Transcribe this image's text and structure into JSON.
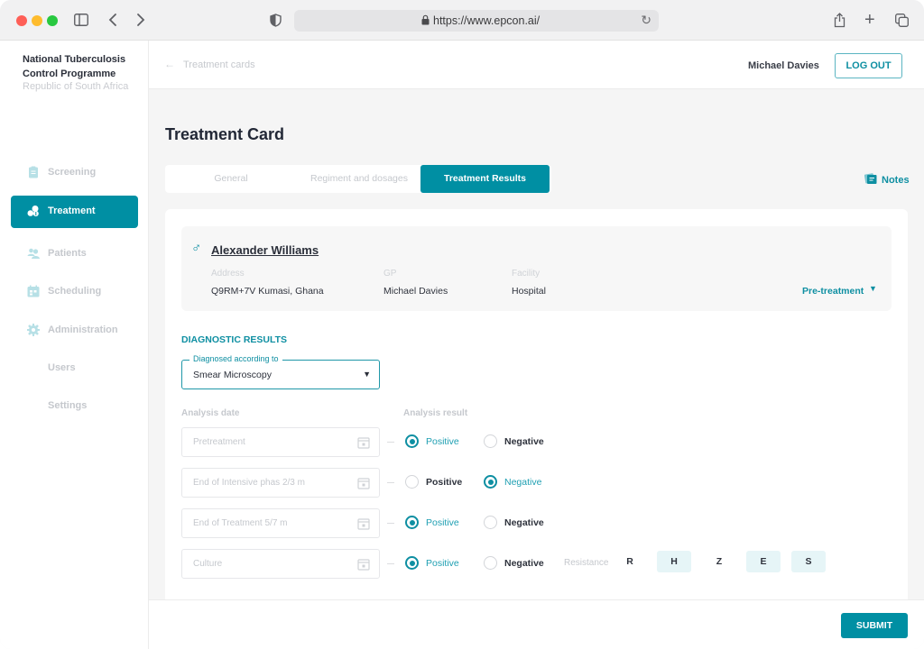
{
  "browser": {
    "url": "https://www.epcon.ai/"
  },
  "sidebar": {
    "org_name": "National Tuberculosis Control Programme",
    "org_country": "Republic of South Africa",
    "items": [
      {
        "label": "Screening",
        "icon": "clipboard-icon",
        "active": false
      },
      {
        "label": "Treatment",
        "icon": "pills-icon",
        "active": true
      },
      {
        "label": "Patients",
        "icon": "users-icon",
        "active": false
      },
      {
        "label": "Scheduling",
        "icon": "calendar-icon",
        "active": false
      },
      {
        "label": "Administration",
        "icon": "gear-icon",
        "active": false
      },
      {
        "label": "Users",
        "icon": "",
        "active": false
      },
      {
        "label": "Settings",
        "icon": "",
        "active": false
      }
    ]
  },
  "topbar": {
    "breadcrumb": "Treatment cards",
    "user_name": "Michael Davies",
    "logout_label": "LOG OUT"
  },
  "page": {
    "title": "Treatment Card",
    "tabs": [
      {
        "label": "General",
        "active": false
      },
      {
        "label": "Regiment and dosages",
        "active": false
      },
      {
        "label": "Treatment Results",
        "active": true
      }
    ],
    "notes_label": "Notes"
  },
  "patient": {
    "name": "Alexander Williams",
    "gender_icon": "male-icon",
    "address_label": "Address",
    "address": "Q9RM+7V Kumasi, Ghana",
    "gp_label": "GP",
    "gp": "Michael Davies",
    "facility_label": "Facility",
    "facility": "Hospital",
    "stage": "Pre-treatment"
  },
  "diagnostic": {
    "section_title": "DIAGNOSTIC RESULTS",
    "diagnosed_label": "Diagnosed according to",
    "diagnosed_value": "Smear Microscopy",
    "analysis_date_label": "Analysis date",
    "analysis_result_label": "Analysis result",
    "positive_label": "Positive",
    "negative_label": "Negative",
    "rows": [
      {
        "date_placeholder": "Pretreatment",
        "result": "Positive"
      },
      {
        "date_placeholder": "End of Intensive phas 2/3 m",
        "result": "Negative"
      },
      {
        "date_placeholder": "End of Treatment 5/7 m",
        "result": "Positive"
      },
      {
        "date_placeholder": "Culture",
        "result": "Positive"
      }
    ],
    "resistance_label": "Resistance",
    "resistance": [
      {
        "label": "R",
        "selected": false
      },
      {
        "label": "H",
        "selected": true
      },
      {
        "label": "Z",
        "selected": false
      },
      {
        "label": "E",
        "selected": true
      },
      {
        "label": "S",
        "selected": true
      }
    ]
  },
  "footer": {
    "submit_label": "SUBMIT"
  },
  "colors": {
    "accent": "#008fa3",
    "accent_text": "#0e8fa2",
    "chip_selected": "#e6f5f7"
  }
}
